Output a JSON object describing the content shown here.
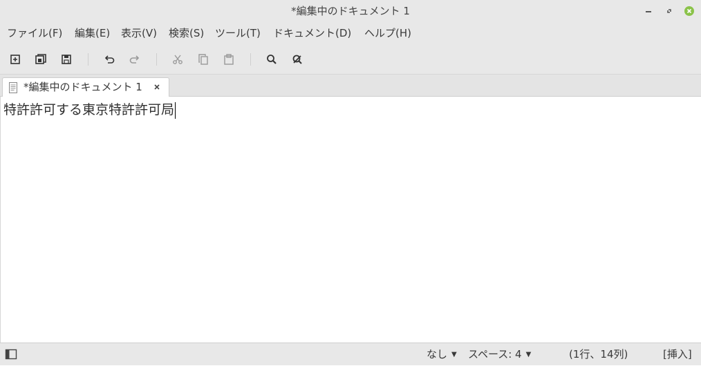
{
  "window": {
    "title": "*編集中のドキュメント 1",
    "controls": [
      "minimize-icon",
      "restore-icon",
      "close-icon"
    ],
    "close_color": "#8bc34a"
  },
  "menu": {
    "items": [
      {
        "label": "ファイル(F)"
      },
      {
        "label": "編集(E)"
      },
      {
        "label": "表示(V)"
      },
      {
        "label": "検索(S)"
      },
      {
        "label": "ツール(T)"
      },
      {
        "label": "ドキュメント(D)"
      },
      {
        "label": "ヘルプ(H)"
      }
    ]
  },
  "toolbar": {
    "buttons": [
      "new-document-icon",
      "open-icon",
      "save-icon",
      "undo-icon",
      "redo-icon",
      "cut-icon",
      "copy-icon",
      "paste-icon",
      "search-icon",
      "replace-icon"
    ]
  },
  "tabs": [
    {
      "label": "*編集中のドキュメント 1",
      "icon": "document-icon",
      "close": "close-tab-icon"
    }
  ],
  "editor": {
    "text": "特許許可する東京特許許可局"
  },
  "statusbar": {
    "highlight_mode": "なし",
    "tab_width": "スペース: 4",
    "position": "(1行、14列)",
    "mode": "[挿入]"
  }
}
